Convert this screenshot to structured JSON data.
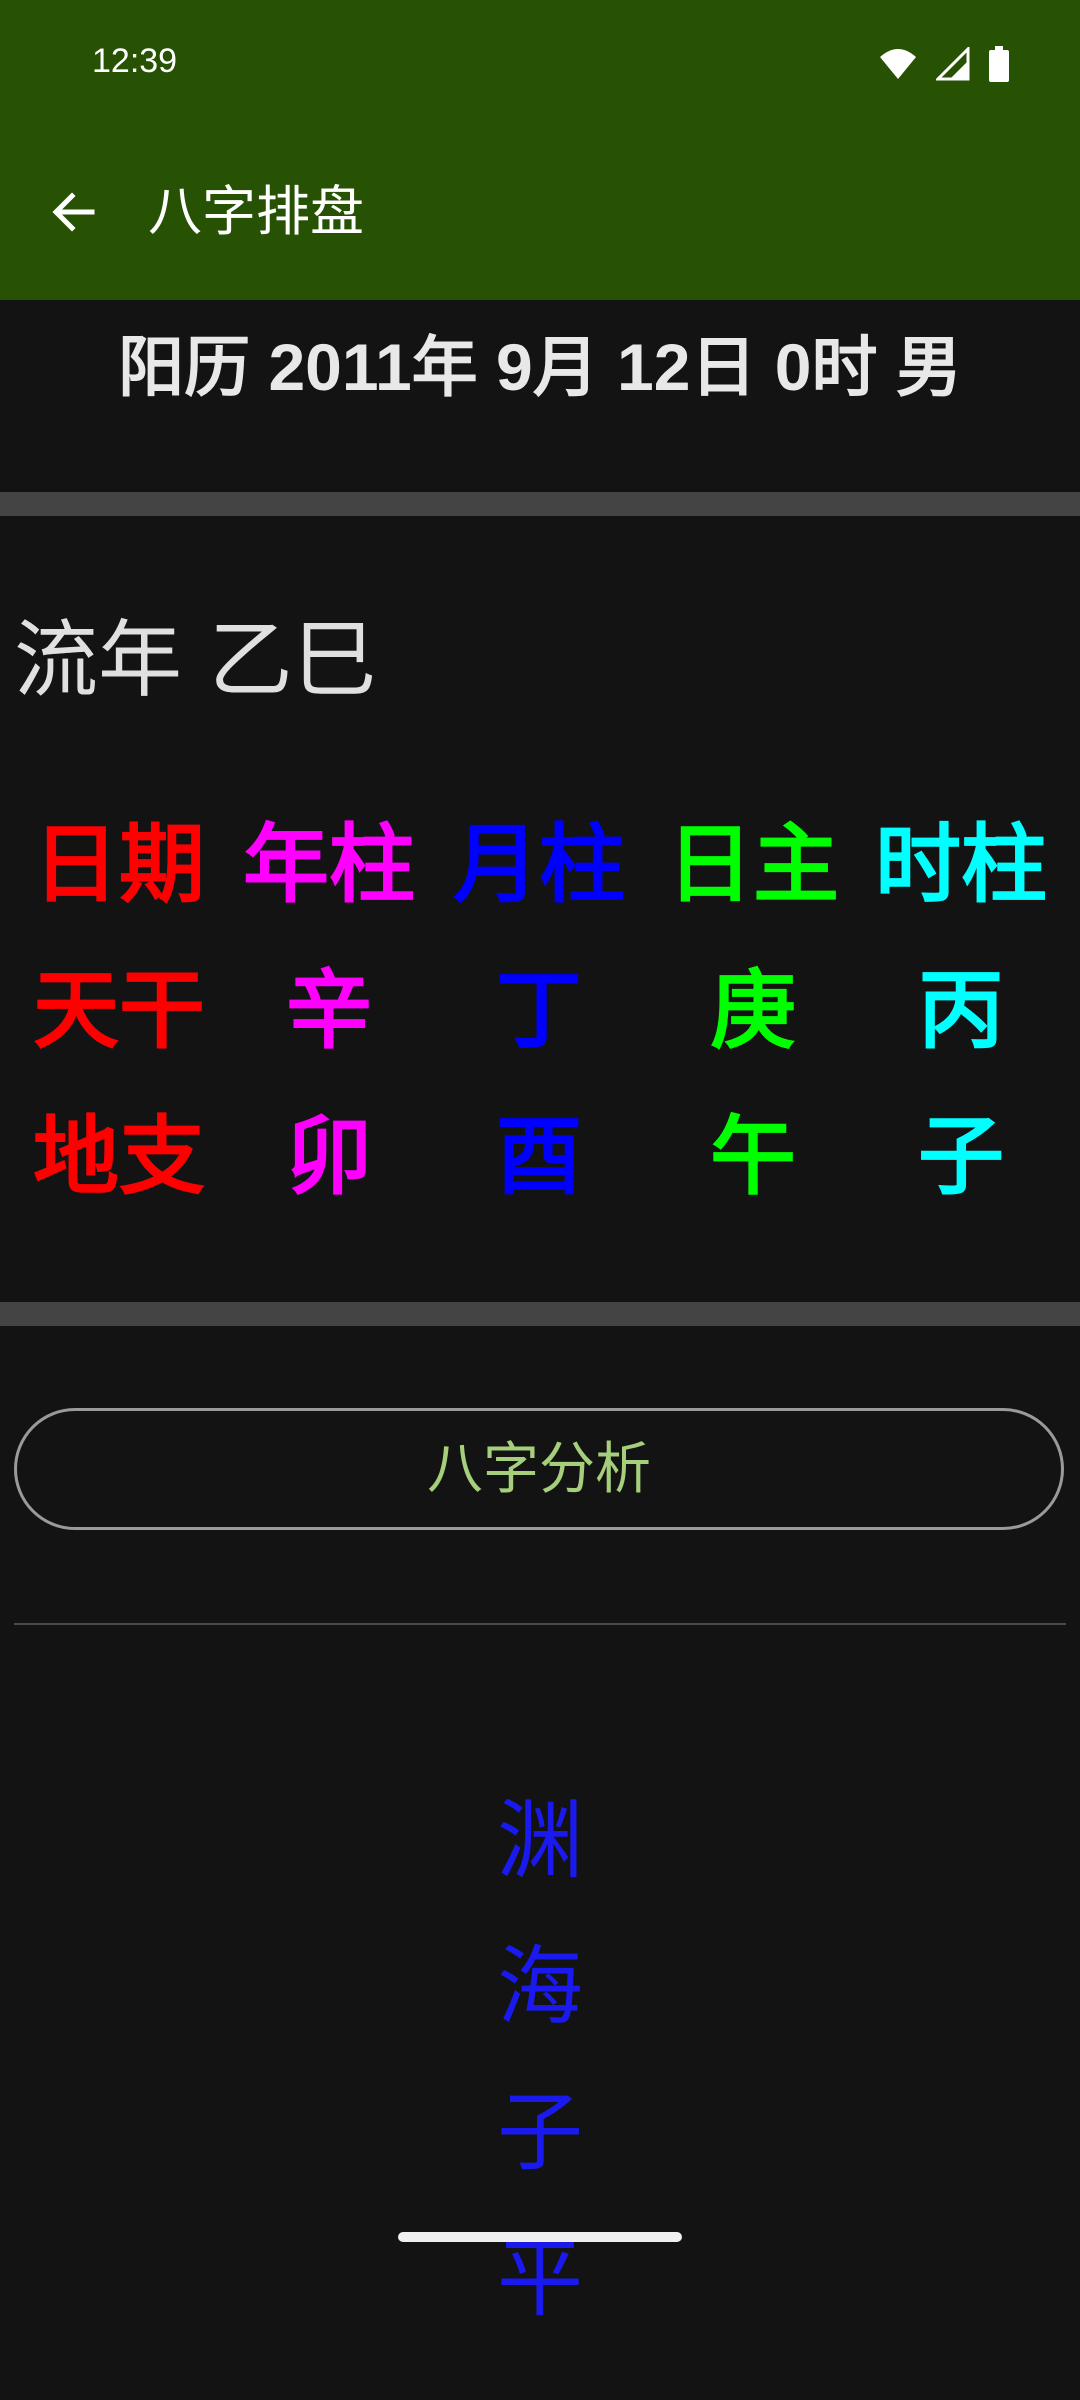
{
  "status_bar": {
    "time": "12:39",
    "icons": [
      "wifi-icon",
      "signal-icon",
      "battery-icon"
    ]
  },
  "app_bar": {
    "title": "八字排盘",
    "back_icon": "arrow-back-icon",
    "background": "#275204"
  },
  "birth_info": "阳历 2011年 9月 12日 0时  男",
  "liunian": "流年 乙巳",
  "pillars": {
    "header": [
      "日期",
      "年柱",
      "月柱",
      "日主",
      "时柱"
    ],
    "tiangan": [
      "天干",
      "辛",
      "丁",
      "庚",
      "丙"
    ],
    "dizhi": [
      "地支",
      "卯",
      "酉",
      "午",
      "子"
    ],
    "colors": [
      "#ff0000",
      "#ff00ff",
      "#0000ff",
      "#00ff00",
      "#00ffff"
    ]
  },
  "analysis_button": "八字分析",
  "vertical_title": [
    "渊",
    "海",
    "子",
    "平"
  ],
  "vertical_title_color": "#1a1aee"
}
